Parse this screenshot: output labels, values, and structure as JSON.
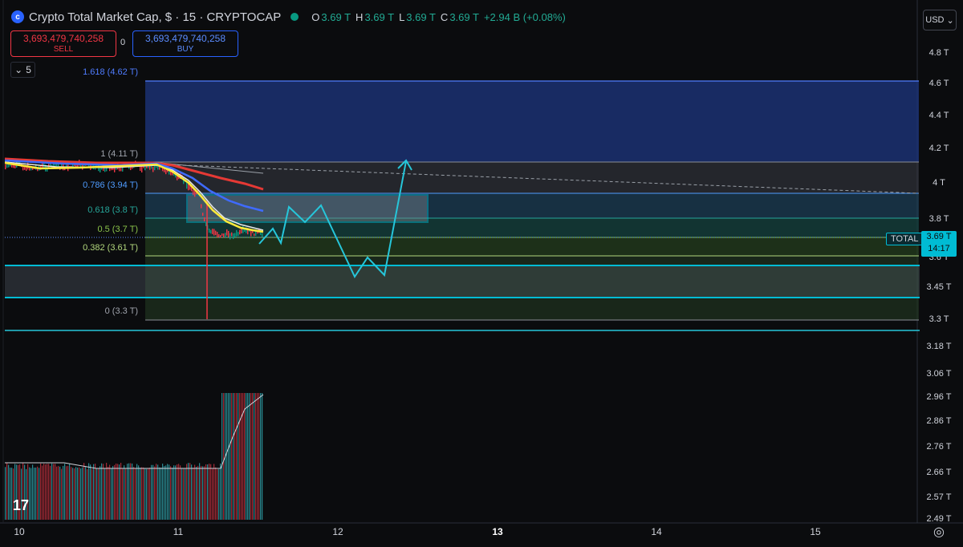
{
  "header": {
    "title": "Crypto Total Market Cap, $ · 15 · CRYPTOCAP",
    "ohlc": {
      "o_label": "O",
      "o": "3.69 T",
      "h_label": "H",
      "h": "3.69 T",
      "l_label": "L",
      "l": "3.69 T",
      "c_label": "C",
      "c": "3.69 T",
      "change": "+2.94 B (+0.08%)"
    }
  },
  "trade": {
    "sell_price": "3,693,479,740,258",
    "sell_label": "SELL",
    "spread": "0",
    "buy_price": "3,693,479,740,258",
    "buy_label": "BUY"
  },
  "indicators_collapsed": {
    "count": "5"
  },
  "currency": {
    "label": "USD"
  },
  "price_axis": {
    "ticks": [
      "4.8 T",
      "4.6 T",
      "4.4 T",
      "4.2 T",
      "4 T",
      "3.8 T",
      "3.6 T",
      "3.45 T",
      "3.3 T",
      "3.18 T",
      "3.06 T",
      "2.96 T",
      "2.86 T",
      "2.76 T",
      "2.66 T",
      "2.57 T",
      "2.49 T"
    ],
    "current_price": "3.69 T",
    "countdown": "14:17",
    "symbol_tag": "TOTAL"
  },
  "time_axis": {
    "labels": [
      "10",
      "11",
      "12",
      "13",
      "14",
      "15"
    ]
  },
  "fib_levels": [
    {
      "label": "1.618 (4.62 T)",
      "color": "#4f7cff"
    },
    {
      "label": "1 (4.11 T)",
      "color": "#a0a4ad"
    },
    {
      "label": "0.786 (3.94 T)",
      "color": "#4f9cff"
    },
    {
      "label": "0.618 (3.8 T)",
      "color": "#26a69a"
    },
    {
      "label": "0.5 (3.7 T)",
      "color": "#8bc34a"
    },
    {
      "label": "0.382 (3.61 T)",
      "color": "#b2d77d"
    },
    {
      "label": "0 (3.3 T)",
      "color": "#a0a4ad"
    }
  ],
  "colors": {
    "accent": "#00bcd4",
    "up": "#089981",
    "down": "#f23645",
    "brand": "#2962ff"
  },
  "icons": {
    "logo": "tradingview-logo-icon",
    "settings": "settings-icon",
    "chevron": "chevron-down-icon"
  }
}
